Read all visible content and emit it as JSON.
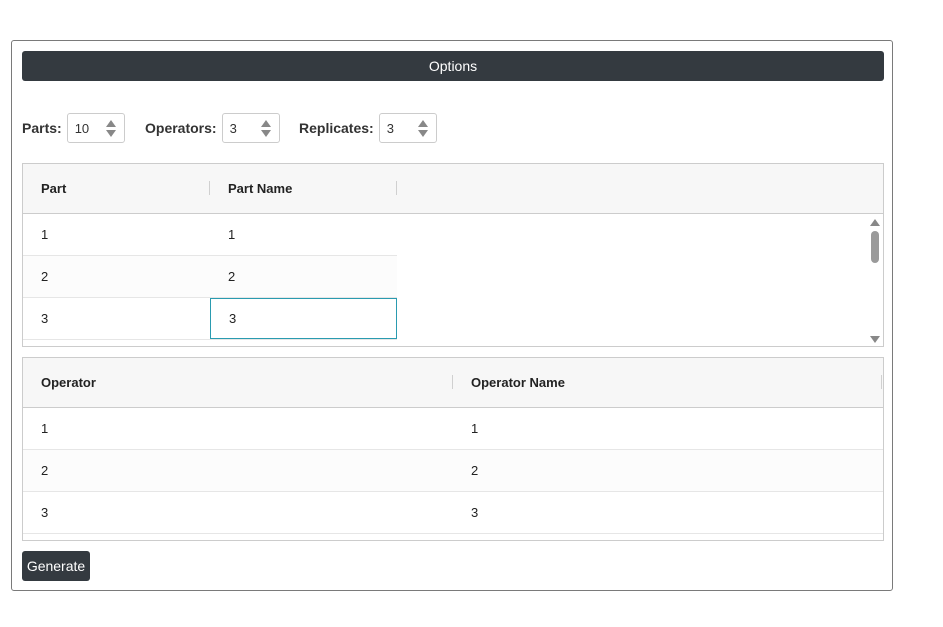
{
  "options": {
    "header": "Options"
  },
  "fields": {
    "parts": {
      "label": "Parts:",
      "value": "10"
    },
    "operators": {
      "label": "Operators:",
      "value": "3"
    },
    "replicates": {
      "label": "Replicates:",
      "value": "3"
    }
  },
  "parts_table": {
    "columns": [
      "Part",
      "Part Name"
    ],
    "rows": [
      {
        "part": "1",
        "name": "1"
      },
      {
        "part": "2",
        "name": "2"
      },
      {
        "part": "3",
        "name": "3"
      }
    ]
  },
  "operators_table": {
    "columns": [
      "Operator",
      "Operator Name"
    ],
    "rows": [
      {
        "operator": "1",
        "name": "1"
      },
      {
        "operator": "2",
        "name": "2"
      },
      {
        "operator": "3",
        "name": "3"
      }
    ]
  },
  "actions": {
    "generate": "Generate"
  },
  "colors": {
    "header_bg": "#343a40",
    "selected_border": "#2a9bb0"
  }
}
